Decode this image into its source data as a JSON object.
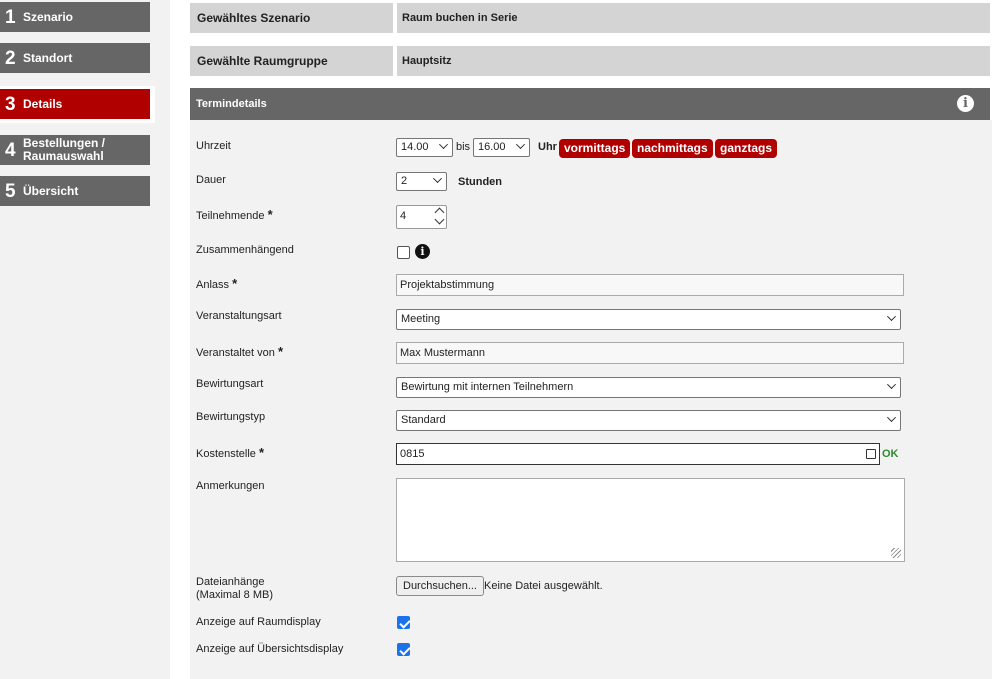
{
  "steps": [
    {
      "num": "1",
      "label": "Szenario"
    },
    {
      "num": "2",
      "label": "Standort"
    },
    {
      "num": "3",
      "label": "Details"
    },
    {
      "num": "4",
      "label1": "Bestellungen /",
      "label2": "Raumauswahl"
    },
    {
      "num": "5",
      "label": "Übersicht"
    }
  ],
  "summary": {
    "scenario_label": "Gewähltes Szenario",
    "scenario_value": "Raum buchen in Serie",
    "group_label": "Gewählte Raumgruppe",
    "group_value": "Hauptsitz"
  },
  "section": {
    "title": "Termindetails",
    "info_icon": "info-circle-icon"
  },
  "form": {
    "time": {
      "label": "Uhrzeit",
      "from": "14.00",
      "to_word": "bis",
      "to": "16.00",
      "unit": "Uhr",
      "presets": [
        "vormittags",
        "nachmittags",
        "ganztags"
      ]
    },
    "duration": {
      "label": "Dauer",
      "value": "2",
      "unit": "Stunden"
    },
    "participants": {
      "label": "Teilnehmende",
      "value": "4"
    },
    "contiguous": {
      "label": "Zusammenhängend",
      "checked": false
    },
    "occasion": {
      "label": "Anlass",
      "value": "Projektabstimmung"
    },
    "event_type": {
      "label": "Veranstaltungsart",
      "value": "Meeting"
    },
    "organizer": {
      "label": "Veranstaltet von",
      "value": "Max Mustermann"
    },
    "catering_kind": {
      "label": "Bewirtungsart",
      "value": "Bewirtung mit internen Teilnehmern"
    },
    "catering_type": {
      "label": "Bewirtungstyp",
      "value": "Standard"
    },
    "cost_center": {
      "label": "Kostenstelle",
      "value": "0815",
      "status": "OK"
    },
    "notes": {
      "label": "Anmerkungen",
      "value": ""
    },
    "attachments": {
      "label1": "Dateianhänge",
      "label2": "(Maximal 8 MB)",
      "button": "Durchsuchen...",
      "status": "Keine Datei ausgewählt."
    },
    "room_display": {
      "label": "Anzeige auf Raumdisplay",
      "checked": true
    },
    "overview_display": {
      "label": "Anzeige auf Übersichtsdisplay",
      "checked": true
    }
  },
  "required_marker": "*",
  "colors": {
    "accent": "#b00000",
    "nav": "#666666",
    "ok": "#2e8b2e",
    "check": "#1a73e8"
  }
}
